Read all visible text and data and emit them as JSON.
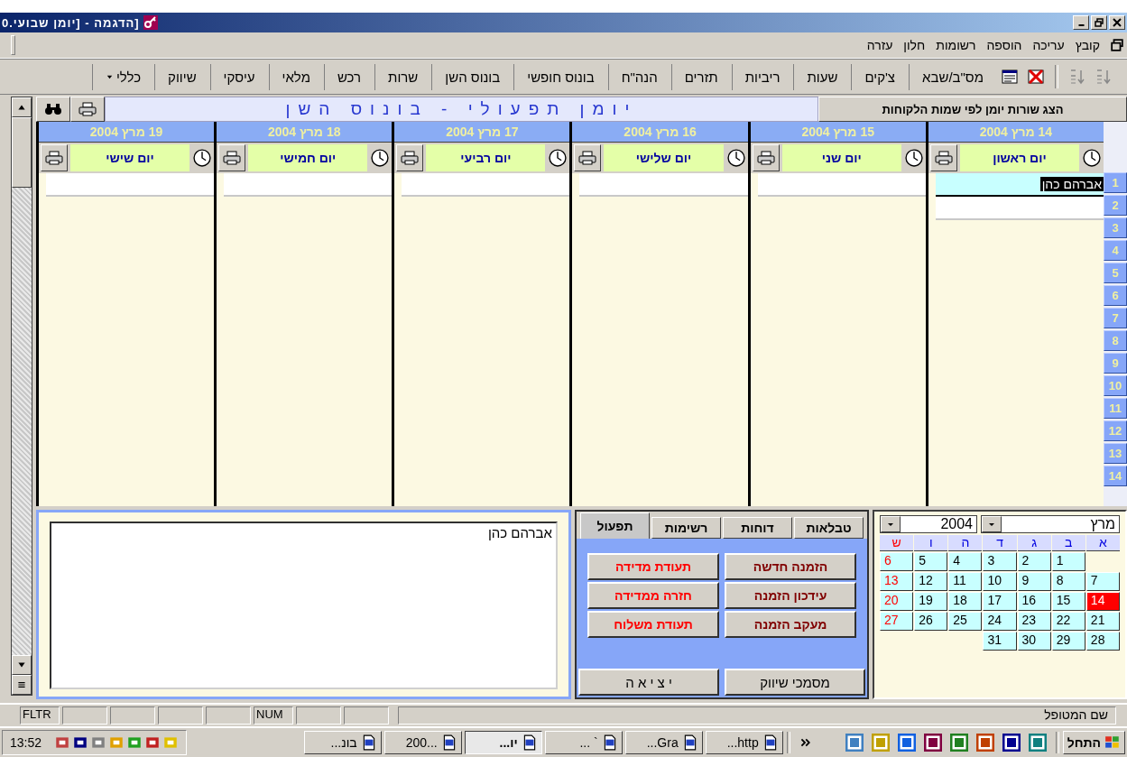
{
  "window": {
    "title": "[הדגמה - [יומן שבועי.0"
  },
  "menu": [
    "קובץ",
    "עריכה",
    "הוספה",
    "רשומות",
    "חלון",
    "עזרה"
  ],
  "toolbar": [
    {
      "label": "מס\"ב/שבא",
      "dropdown": false
    },
    {
      "label": "צ'קים",
      "dropdown": false
    },
    {
      "label": "שעות",
      "dropdown": false
    },
    {
      "label": "ריביות",
      "dropdown": false
    },
    {
      "label": "תזרים",
      "dropdown": false
    },
    {
      "label": "הנה\"ח",
      "dropdown": false
    },
    {
      "label": "בונוס חופשי",
      "dropdown": false
    },
    {
      "label": "בונוס השן",
      "dropdown": false
    },
    {
      "label": "שרות",
      "dropdown": false
    },
    {
      "label": "רכש",
      "dropdown": false
    },
    {
      "label": "מלאי",
      "dropdown": false
    },
    {
      "label": "עיסקי",
      "dropdown": false
    },
    {
      "label": "שיווק",
      "dropdown": false
    },
    {
      "label": "כללי",
      "dropdown": true
    }
  ],
  "journal": {
    "title": "יומן תפעולי - בונוס השן",
    "show_by_client_button": "הצג שורות יומן לפי שמות הלקוחות"
  },
  "days": [
    {
      "date": "14 מרץ 2004",
      "name": "יום ראשון",
      "entries": [
        {
          "text": "אברהם כהן",
          "selected": true
        }
      ]
    },
    {
      "date": "15 מרץ 2004",
      "name": "יום שני"
    },
    {
      "date": "16 מרץ 2004",
      "name": "יום שלישי"
    },
    {
      "date": "17 מרץ 2004",
      "name": "יום רביעי"
    },
    {
      "date": "18 מרץ 2004",
      "name": "יום חמישי"
    },
    {
      "date": "19 מרץ 2004",
      "name": "יום שישי"
    }
  ],
  "row_numbers": [
    "1",
    "2",
    "3",
    "4",
    "5",
    "6",
    "7",
    "8",
    "9",
    "10",
    "11",
    "12",
    "13",
    "14"
  ],
  "notes": {
    "value": "אברהם כהן"
  },
  "tabs": [
    {
      "label": "טבלאות",
      "selected": false
    },
    {
      "label": "דוחות",
      "selected": false
    },
    {
      "label": "רשימות",
      "selected": false
    },
    {
      "label": "תפעול",
      "selected": true
    }
  ],
  "actions": [
    {
      "label": "הזמנה חדשה",
      "color": "#800000"
    },
    {
      "label": "תעודת מדידה",
      "color": "#ff0000"
    },
    {
      "label": "עידכון הזמנה",
      "color": "#800000"
    },
    {
      "label": "חזרה ממדידה",
      "color": "#ff0000"
    },
    {
      "label": "מעקב הזמנה",
      "color": "#800000"
    },
    {
      "label": "תעודת משלוח",
      "color": "#ff0000"
    }
  ],
  "footer_buttons": [
    "מסמכי שיווק",
    "י צ י א ה"
  ],
  "calendar": {
    "month": "מרץ",
    "year": "2004",
    "weekdays": [
      {
        "label": "א",
        "weekend": false
      },
      {
        "label": "ב",
        "weekend": false
      },
      {
        "label": "ג",
        "weekend": false
      },
      {
        "label": "ד",
        "weekend": false
      },
      {
        "label": "ה",
        "weekend": false
      },
      {
        "label": "ו",
        "weekend": false
      },
      {
        "label": "ש",
        "weekend": true
      }
    ],
    "weeks": [
      [
        {
          "day": "1",
          "selected": false
        },
        {
          "day": "2",
          "selected": false
        },
        {
          "day": "3",
          "selected": false
        },
        {
          "day": "4",
          "selected": false
        },
        {
          "day": "5",
          "selected": false
        },
        {
          "day": "6",
          "selected": false
        }
      ],
      [
        {
          "day": "7",
          "selected": false
        },
        {
          "day": "8",
          "selected": false
        },
        {
          "day": "9",
          "selected": false
        },
        {
          "day": "10",
          "selected": false
        },
        {
          "day": "11",
          "selected": false
        },
        {
          "day": "12",
          "selected": false
        },
        {
          "day": "13",
          "selected": false
        }
      ],
      [
        {
          "day": "14",
          "selected": true
        },
        {
          "day": "15",
          "selected": false
        },
        {
          "day": "16",
          "selected": false
        },
        {
          "day": "17",
          "selected": false
        },
        {
          "day": "18",
          "selected": false
        },
        {
          "day": "19",
          "selected": false
        },
        {
          "day": "20",
          "selected": false
        }
      ],
      [
        {
          "day": "21",
          "selected": false
        },
        {
          "day": "22",
          "selected": false
        },
        {
          "day": "23",
          "selected": false
        },
        {
          "day": "24",
          "selected": false
        },
        {
          "day": "25",
          "selected": false
        },
        {
          "day": "26",
          "selected": false
        },
        {
          "day": "27",
          "selected": false
        }
      ],
      [
        {
          "day": "28",
          "selected": false
        },
        {
          "day": "29",
          "selected": false
        },
        {
          "day": "30",
          "selected": false
        },
        {
          "day": "31",
          "selected": false
        }
      ]
    ]
  },
  "status_bar": {
    "text": "שם המטופל",
    "filter": "FLTR",
    "num": "NUM"
  },
  "taskbar": {
    "start": "התחל",
    "clock": "13:52",
    "tasks": [
      {
        "label": "...http",
        "selected": false
      },
      {
        "label": "...Gra",
        "selected": false
      },
      {
        "label": "... `",
        "selected": false
      },
      {
        "label": "...יו",
        "selected": true
      },
      {
        "label": "200...",
        "selected": false
      },
      {
        "label": "...בונ",
        "selected": false
      }
    ]
  }
}
